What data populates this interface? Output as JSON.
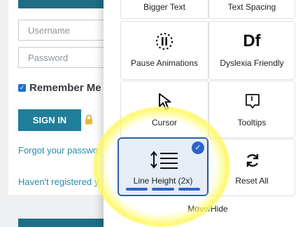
{
  "login": {
    "username_placeholder": "Username",
    "password_placeholder": "Password",
    "remember_label": "Remember Me",
    "signin_label": "SIGN IN",
    "forgot_link": "Forgot your passwo",
    "register_link": "Haven't registered y"
  },
  "widget": {
    "tiles": [
      {
        "label": "Bigger Text",
        "icon": "text-size-icon"
      },
      {
        "label": "Text Spacing",
        "icon": "text-spacing-icon"
      },
      {
        "label": "Pause Animations",
        "icon": "pause-icon"
      },
      {
        "label": "Dyslexia Friendly",
        "icon": "dyslexia-icon",
        "glyph": "Df"
      },
      {
        "label": "Cursor",
        "icon": "cursor-icon"
      },
      {
        "label": "Tooltips",
        "icon": "tooltip-icon",
        "glyph": "i"
      },
      {
        "label": "Line Height (2x)",
        "icon": "line-height-icon",
        "selected": true,
        "level_steps_filled": 3
      },
      {
        "label": "Reset All",
        "icon": "reset-icon"
      }
    ],
    "move_hide_label": "Move/Hide"
  },
  "colors": {
    "accent": "#1f7f9a",
    "selected_border": "#2c5fa3",
    "check_badge": "#2c64c8",
    "highlight": "#fff75a"
  }
}
